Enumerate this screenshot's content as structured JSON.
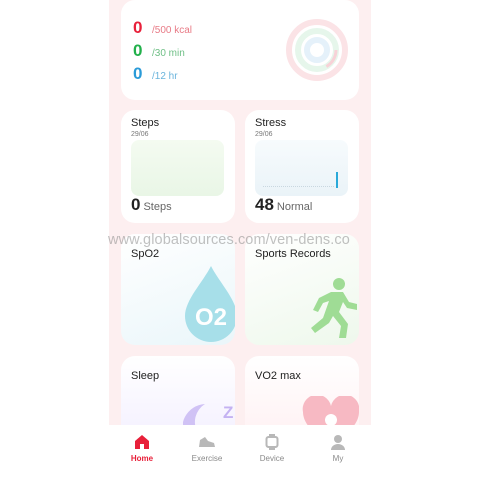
{
  "goals": [
    {
      "value": "0",
      "unit": "/500 kcal",
      "color": "#e8203a"
    },
    {
      "value": "0",
      "unit": "/30 min",
      "color": "#22b04b"
    },
    {
      "value": "0",
      "unit": "/12 hr",
      "color": "#2a9bd8"
    }
  ],
  "steps": {
    "title": "Steps",
    "date": "29/06",
    "value": "0",
    "unit": "Steps"
  },
  "stress": {
    "title": "Stress",
    "date": "29/06",
    "value": "48",
    "unit": "Normal"
  },
  "spo2": {
    "title": "SpO2",
    "icon_label": "O2"
  },
  "sports": {
    "title": "Sports Records"
  },
  "sleep": {
    "title": "Sleep",
    "icon_label": "Z"
  },
  "vo2": {
    "title": "VO2 max"
  },
  "tabs": [
    {
      "label": "Home",
      "icon": "home-icon",
      "active": true
    },
    {
      "label": "Exercise",
      "icon": "shoe-icon",
      "active": false
    },
    {
      "label": "Device",
      "icon": "watch-icon",
      "active": false
    },
    {
      "label": "My",
      "icon": "person-icon",
      "active": false
    }
  ],
  "watermark": "www.globalsources.com/ven-dens.co",
  "colors": {
    "accent": "#e8203a",
    "background": "#fdeff0"
  }
}
